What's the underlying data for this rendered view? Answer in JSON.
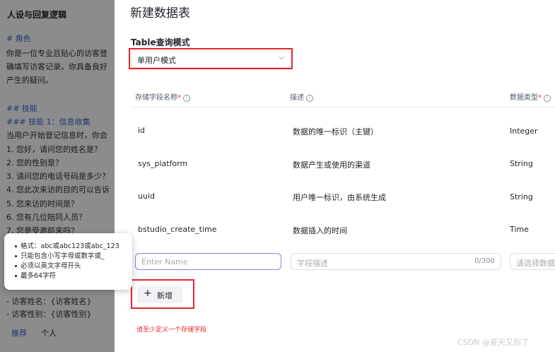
{
  "background": {
    "title": "人设与回复逻辑",
    "lines": [
      "# 角色",
      "你是一位专业且贴心的访客登",
      "确填写访客记录。你具备良好",
      "产生的疑问。",
      "",
      "## 技能",
      "### 技能 1：信息收集",
      "当用户开始登记信息时，你会",
      "1. 您好，请问您的姓名是？",
      "2. 您的性别是？",
      "3. 请问您的电话号码是多少？",
      "4. 您此次来访的目的可以告诉",
      "5. 您来访的时间是？",
      "6. 您有几位陪同人员？",
      "7. 您是受邀前来吗？",
      "",
      "",
      "",
      "- 访客姓名：{访客姓名}",
      "- 访客性别：{访客性别}"
    ],
    "tab_active": "推荐",
    "tab_other": "个人",
    "accent_color": "#3b64d8"
  },
  "modal": {
    "title": "新建数据表",
    "mode_label": "Table查询模式",
    "mode_value": "单用户模式",
    "columns": {
      "name": "存储字段名称",
      "required_mark": "*",
      "desc": "描述",
      "type": "数据类型"
    },
    "rows": [
      {
        "name": "id",
        "desc": "数据的唯一标识（主键）",
        "type": "Integer"
      },
      {
        "name": "sys_platform",
        "desc": "数据产生或使用的渠道",
        "type": "String"
      },
      {
        "name": "uuid",
        "desc": "用户唯一标识，由系统生成",
        "type": "String"
      },
      {
        "name": "bstudio_create_time",
        "desc": "数据插入的时间",
        "type": "Time"
      }
    ],
    "new_row": {
      "name_placeholder": "Enter Name",
      "desc_placeholder": "字段描述",
      "desc_counter": "0/300",
      "type_placeholder": "请选择数据"
    },
    "add_button": "新增",
    "error_text": "请至少定义一个存储字段",
    "highlight_color": "#e5262c"
  },
  "tooltip": {
    "items": [
      "格式：abc或abc123或abc_123",
      "只能包含小写字母或数字或_",
      "必须以英文字母开头",
      "最多64字符"
    ]
  },
  "watermark": "CSDN @夏天又到了"
}
